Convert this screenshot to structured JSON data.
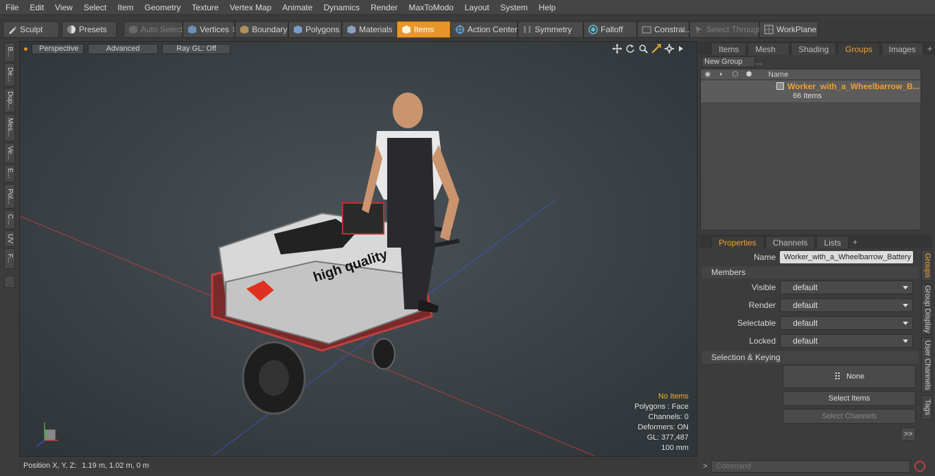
{
  "menu": [
    "File",
    "Edit",
    "View",
    "Select",
    "Item",
    "Geometry",
    "Texture",
    "Vertex Map",
    "Animate",
    "Dynamics",
    "Render",
    "MaxToModo",
    "Layout",
    "System",
    "Help"
  ],
  "toolbar": {
    "sculpt": "Sculpt",
    "presets": "Presets",
    "auto_select": "Auto Select",
    "vertices": "Vertices",
    "vertices_count": "1",
    "boundary": "Boundary",
    "polygons": "Polygons",
    "materials": "Materials",
    "items": "Items",
    "action_center": "Action Center",
    "symmetry": "Symmetry",
    "falloff": "Falloff",
    "constrain": "Constrai...",
    "select_through": "Select Through",
    "workplane": "WorkPlane"
  },
  "left_tabs": [
    "B...",
    "De...",
    "Dup...",
    "Mes...",
    "Ve...",
    "E...",
    "Pol...",
    "C...",
    "UV",
    "F..."
  ],
  "viewport": {
    "view_mode": "Perspective",
    "shading": "Advanced",
    "raygl": "Ray GL: Off",
    "stats": {
      "selection": "No Items",
      "polygons": "Polygons : Face",
      "channels": "Channels: 0",
      "deformers": "Deformers: ON",
      "gl": "GL: 377,487",
      "scale": "100 mm"
    },
    "bag_text": "high quality"
  },
  "status": {
    "label": "Position X, Y, Z:",
    "value": "1.19 m, 1.02 m, 0 m"
  },
  "groups_panel": {
    "tabs": [
      "Items",
      "Mesh ...",
      "Shading",
      "Groups",
      "Images"
    ],
    "active_tab": "Groups",
    "new_group": "New Group",
    "name_header": "Name",
    "group_name": "Worker_with_a_Wheelbarrow_B...",
    "group_count": "66 Items"
  },
  "properties": {
    "tabs": [
      "Properties",
      "Channels",
      "Lists"
    ],
    "name_label": "Name",
    "name_value": "Worker_with_a_Wheelbarrow_Battery",
    "members_header": "Members",
    "visible_label": "Visible",
    "visible_value": "default",
    "render_label": "Render",
    "render_value": "default",
    "selectable_label": "Selectable",
    "selectable_value": "default",
    "locked_label": "Locked",
    "locked_value": "default",
    "sel_header": "Selection & Keying",
    "none_label": "None",
    "select_items": "Select Items",
    "select_channels": "Select Channels",
    "more": ">>"
  },
  "side_tabs": [
    "Groups",
    "Group Display",
    "User Channels",
    "Tags"
  ],
  "command": {
    "placeholder": "Command"
  },
  "colors": {
    "accent": "#f0a030",
    "active_tool": "#e8952c",
    "viewport_bg": "#3b4247"
  }
}
